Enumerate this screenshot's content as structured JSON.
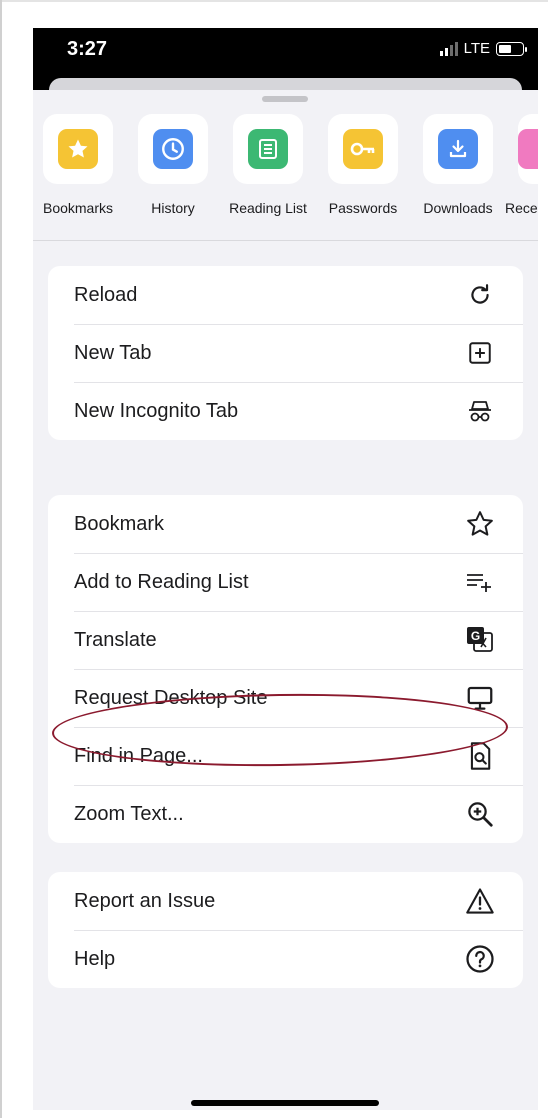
{
  "status_bar": {
    "time": "3:27",
    "network": "LTE"
  },
  "shortcuts": [
    {
      "label": "Bookmarks",
      "icon": "star-icon",
      "color": "#f5c434"
    },
    {
      "label": "History",
      "icon": "clock-icon",
      "color": "#4f8ef0"
    },
    {
      "label": "Reading List",
      "icon": "list-icon",
      "color": "#3cb873"
    },
    {
      "label": "Passwords",
      "icon": "key-icon",
      "color": "#f5c434"
    },
    {
      "label": "Downloads",
      "icon": "download-icon",
      "color": "#4f8ef0"
    },
    {
      "label": "Rece",
      "icon": "recent-tabs-icon",
      "color": "#f07ac0"
    }
  ],
  "menu_groups": [
    [
      {
        "label": "Reload",
        "icon": "reload-icon"
      },
      {
        "label": "New Tab",
        "icon": "new-tab-icon"
      },
      {
        "label": "New Incognito Tab",
        "icon": "incognito-icon"
      }
    ],
    [
      {
        "label": "Bookmark",
        "icon": "star-outline-icon"
      },
      {
        "label": "Add to Reading List",
        "icon": "add-to-list-icon"
      },
      {
        "label": "Translate",
        "icon": "translate-icon"
      },
      {
        "label": "Request Desktop Site",
        "icon": "desktop-icon",
        "highlighted": true
      },
      {
        "label": "Find in Page...",
        "icon": "find-in-page-icon"
      },
      {
        "label": "Zoom Text...",
        "icon": "zoom-in-icon"
      }
    ],
    [
      {
        "label": "Report an Issue",
        "icon": "warning-icon"
      },
      {
        "label": "Help",
        "icon": "help-icon"
      }
    ]
  ],
  "colors": {
    "annotation": "#8b1a2e",
    "sheet_background": "#f2f2f6"
  }
}
